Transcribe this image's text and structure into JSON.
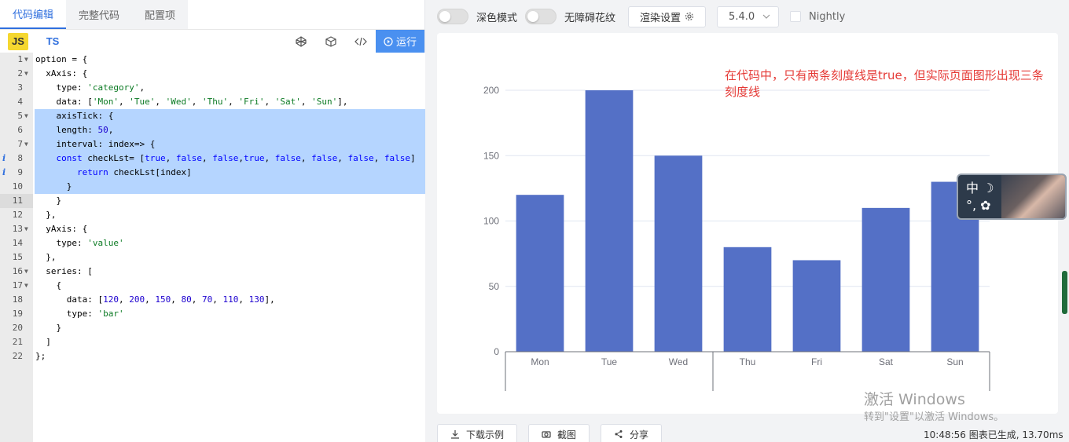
{
  "tabs": [
    "代码编辑",
    "完整代码",
    "配置项"
  ],
  "lang_tabs": [
    "JS",
    "TS"
  ],
  "run_label": "运行",
  "code_lines": [
    {
      "n": "1",
      "fold": true,
      "info": false,
      "text": "option = {"
    },
    {
      "n": "2",
      "fold": true,
      "info": false,
      "text": "  xAxis: {"
    },
    {
      "n": "3",
      "fold": false,
      "info": false,
      "text": "    type: 'category',"
    },
    {
      "n": "4",
      "fold": false,
      "info": false,
      "text": "    data: ['Mon', 'Tue', 'Wed', 'Thu', 'Fri', 'Sat', 'Sun'],"
    },
    {
      "n": "5",
      "fold": true,
      "info": false,
      "text": "    axisTick: {"
    },
    {
      "n": "6",
      "fold": false,
      "info": false,
      "text": "    length: 50,"
    },
    {
      "n": "7",
      "fold": true,
      "info": false,
      "text": "    interval: index=> {"
    },
    {
      "n": "8",
      "fold": false,
      "info": true,
      "text": "    const checkLst= [true, false, false,true, false, false, false, false]"
    },
    {
      "n": "9",
      "fold": false,
      "info": true,
      "text": "        return checkLst[index]"
    },
    {
      "n": "10",
      "fold": false,
      "info": false,
      "text": "      }"
    },
    {
      "n": "11",
      "fold": false,
      "info": false,
      "text": "    }"
    },
    {
      "n": "12",
      "fold": false,
      "info": false,
      "text": "  },"
    },
    {
      "n": "13",
      "fold": true,
      "info": false,
      "text": "  yAxis: {"
    },
    {
      "n": "14",
      "fold": false,
      "info": false,
      "text": "    type: 'value'"
    },
    {
      "n": "15",
      "fold": false,
      "info": false,
      "text": "  },"
    },
    {
      "n": "16",
      "fold": true,
      "info": false,
      "text": "  series: ["
    },
    {
      "n": "17",
      "fold": true,
      "info": false,
      "text": "    {"
    },
    {
      "n": "18",
      "fold": false,
      "info": false,
      "text": "      data: [120, 200, 150, 80, 70, 110, 130],"
    },
    {
      "n": "19",
      "fold": false,
      "info": false,
      "text": "      type: 'bar'"
    },
    {
      "n": "20",
      "fold": false,
      "info": false,
      "text": "    }"
    },
    {
      "n": "21",
      "fold": false,
      "info": false,
      "text": "  ]"
    },
    {
      "n": "22",
      "fold": false,
      "info": false,
      "text": "};"
    }
  ],
  "toolbar": {
    "dark_mode": "深色模式",
    "accessible": "无障碍花纹",
    "render_settings": "渲染设置",
    "version": "5.4.0",
    "nightly": "Nightly"
  },
  "annotation": "在代码中，只有两条刻度线是true，但实际页面图形出现三条刻度线",
  "ime": {
    "line1": "中 ☽",
    "line2": "°, ✿"
  },
  "watermark": {
    "line1": "激活 Windows",
    "line2": "转到\"设置\"以激活 Windows。"
  },
  "bottom": {
    "download": "下载示例",
    "screenshot": "截图",
    "share": "分享"
  },
  "status": "10:48:56  图表已生成, 13.70ms",
  "colors": {
    "bar": "#5470c6",
    "accent": "#2f6fde",
    "annotation": "#e53935"
  },
  "chart_data": {
    "type": "bar",
    "categories": [
      "Mon",
      "Tue",
      "Wed",
      "Thu",
      "Fri",
      "Sat",
      "Sun"
    ],
    "values": [
      120,
      200,
      150,
      80,
      70,
      110,
      130
    ],
    "ylim": [
      0,
      200
    ],
    "yticks": [
      0,
      50,
      100,
      150,
      200
    ],
    "tick_marks_after_category_index": [
      0,
      3
    ]
  }
}
